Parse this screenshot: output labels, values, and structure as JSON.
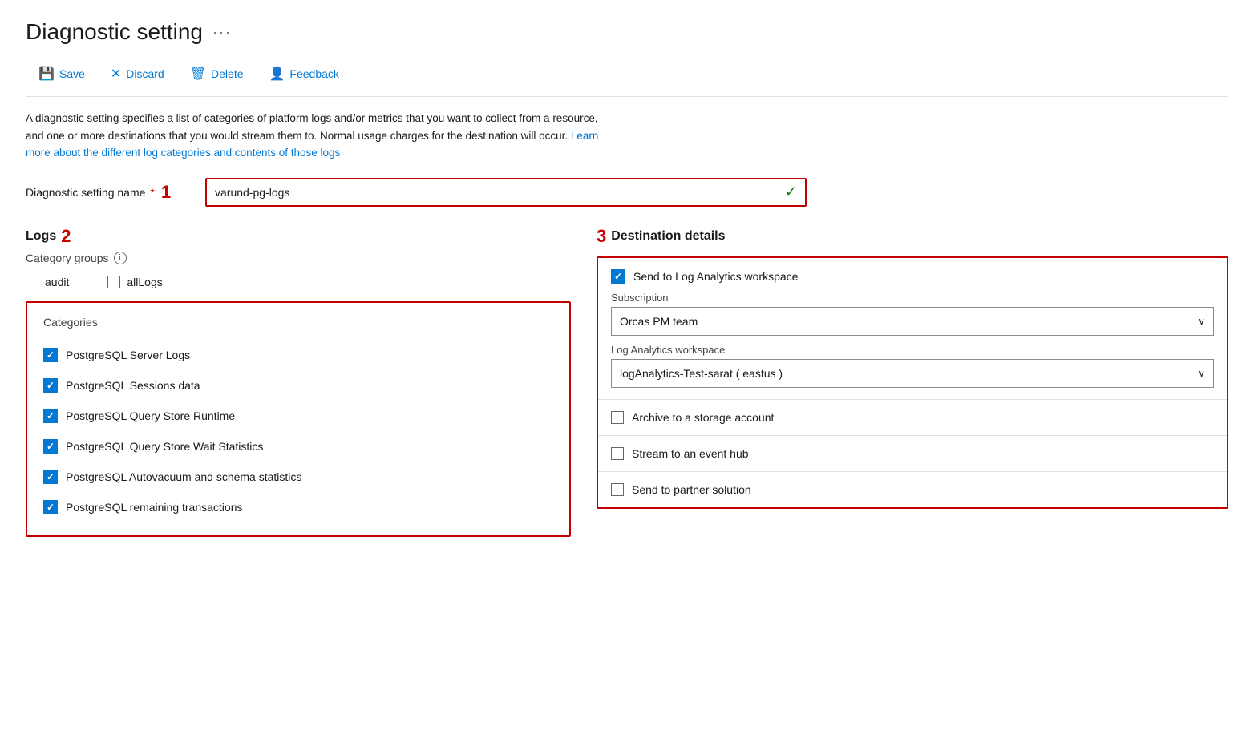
{
  "page": {
    "title": "Diagnostic setting",
    "ellipsis": "···"
  },
  "toolbar": {
    "save_label": "Save",
    "discard_label": "Discard",
    "delete_label": "Delete",
    "feedback_label": "Feedback"
  },
  "description": {
    "text1": "A diagnostic setting specifies a list of categories of platform logs and/or metrics that you want to collect from a resource, and one or more destinations that you would stream them to. Normal usage charges for the destination will occur.",
    "link_text": "Learn more about the different log categories and contents of those logs",
    "link_href": "#"
  },
  "form": {
    "name_label": "Diagnostic setting name",
    "name_required": "*",
    "step1": "1",
    "name_value": "varund-pg-logs"
  },
  "logs": {
    "section_title": "Logs",
    "step2": "2",
    "category_groups_label": "Category groups",
    "groups": [
      {
        "label": "audit",
        "checked": false
      },
      {
        "label": "allLogs",
        "checked": false
      }
    ],
    "categories_title": "Categories",
    "categories": [
      {
        "label": "PostgreSQL Server Logs",
        "checked": true
      },
      {
        "label": "PostgreSQL Sessions data",
        "checked": true
      },
      {
        "label": "PostgreSQL Query Store Runtime",
        "checked": true
      },
      {
        "label": "PostgreSQL Query Store Wait Statistics",
        "checked": true
      },
      {
        "label": "PostgreSQL Autovacuum and schema statistics",
        "checked": true
      },
      {
        "label": "PostgreSQL remaining transactions",
        "checked": true
      }
    ]
  },
  "destination": {
    "section_title": "Destination details",
    "step3": "3",
    "items": [
      {
        "label": "Send to Log Analytics workspace",
        "checked": true,
        "has_sub": true
      },
      {
        "label": "Archive to a storage account",
        "checked": false,
        "has_sub": false
      },
      {
        "label": "Stream to an event hub",
        "checked": false,
        "has_sub": false
      },
      {
        "label": "Send to partner solution",
        "checked": false,
        "has_sub": false
      }
    ],
    "subscription_label": "Subscription",
    "subscription_value": "Orcas PM team",
    "workspace_label": "Log Analytics workspace",
    "workspace_value": "logAnalytics-Test-sarat ( eastus )"
  }
}
